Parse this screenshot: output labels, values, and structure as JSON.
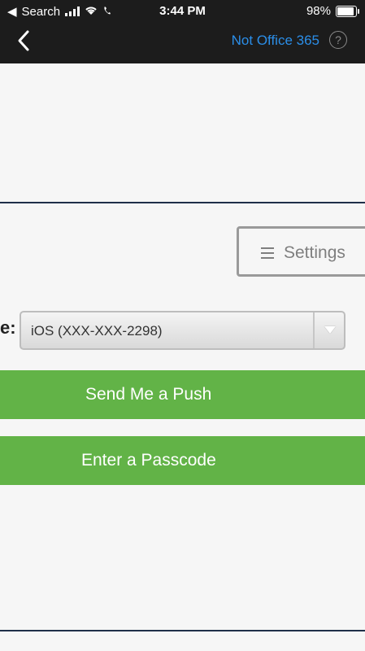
{
  "status_bar": {
    "back_app": "Search",
    "time": "3:44 PM",
    "battery_pct": "98%"
  },
  "nav": {
    "not_office_label": "Not Office 365",
    "help_symbol": "?"
  },
  "settings": {
    "label": "Settings"
  },
  "device": {
    "label_fragment": "e:",
    "selected": "iOS (XXX-XXX-2298)"
  },
  "actions": {
    "push_label": "Send Me a Push",
    "passcode_label": "Enter a Passcode"
  },
  "colors": {
    "green": "#62b347",
    "link_blue": "#2b8ee8",
    "dark_bar": "#1c1c1c"
  }
}
